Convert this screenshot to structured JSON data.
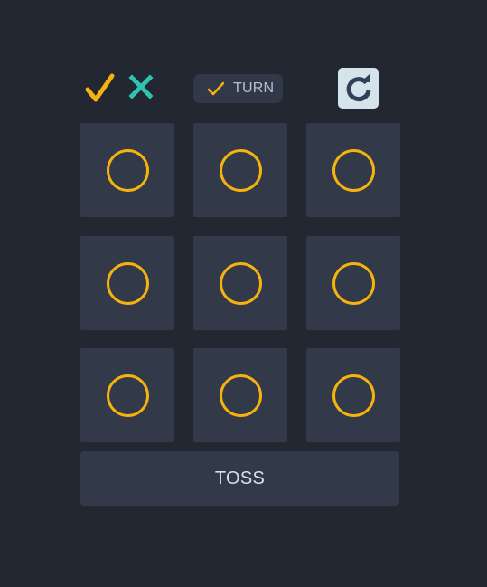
{
  "header": {
    "logo_icons": [
      "check-icon",
      "x-icon"
    ],
    "turn": {
      "icon": "check-icon",
      "label": "TURN"
    },
    "restart_icon": "restart-icon"
  },
  "board": {
    "cells": [
      "O",
      "O",
      "O",
      "O",
      "O",
      "O",
      "O",
      "O",
      "O"
    ]
  },
  "actions": {
    "toss_label": "TOSS"
  },
  "colors": {
    "background": "#222732",
    "tile": "#323949",
    "accent_yellow": "#f6b20e",
    "accent_teal": "#30c4b0",
    "restart_bg": "#d5e3ea",
    "restart_icon": "#34405a"
  }
}
